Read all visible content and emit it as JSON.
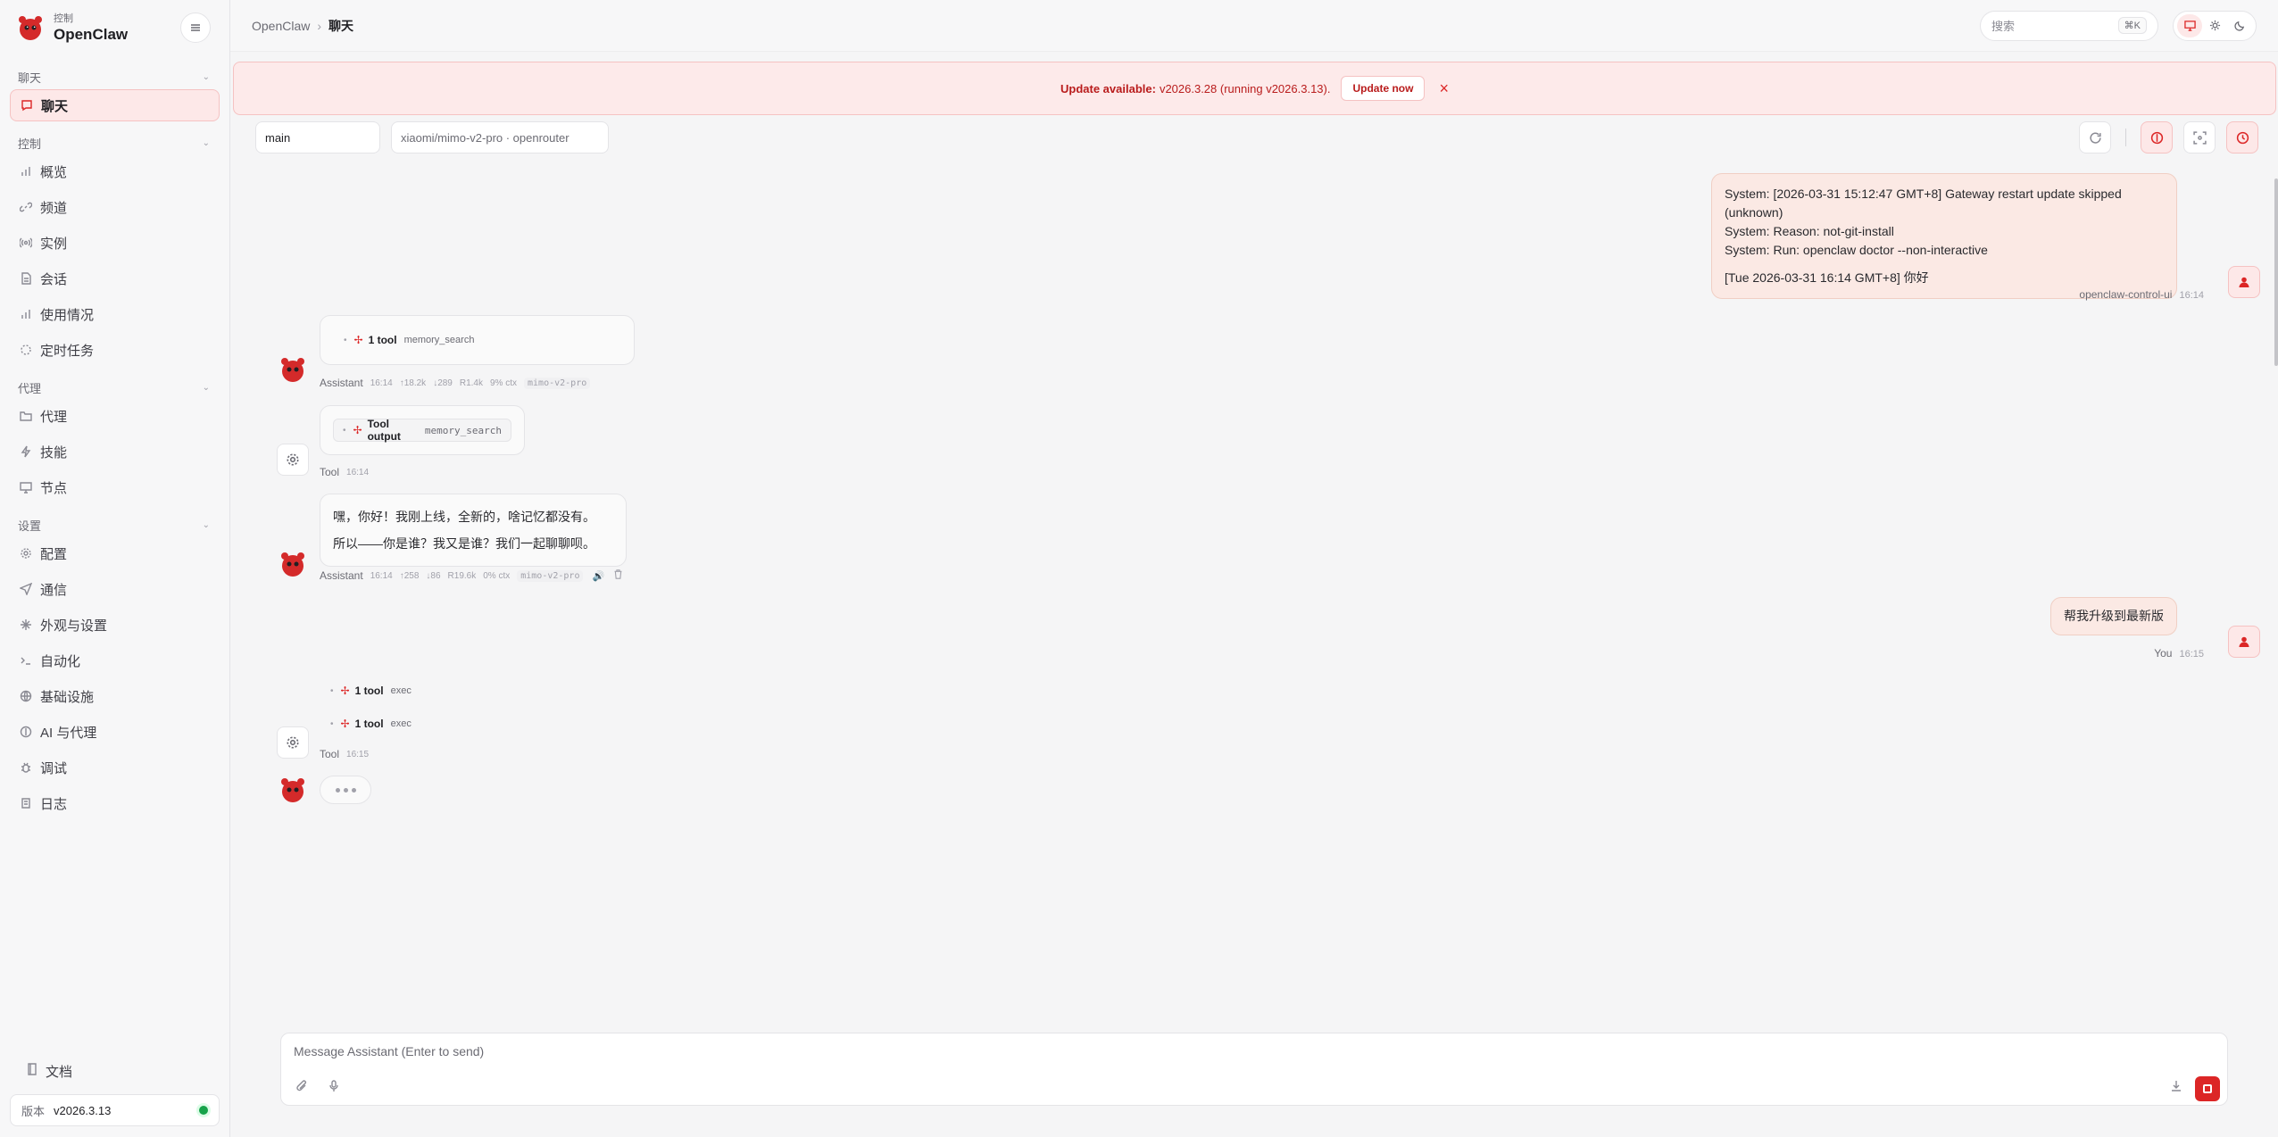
{
  "brand": {
    "sub": "控制",
    "name": "OpenClaw"
  },
  "sidebar": {
    "groups": [
      {
        "label": "聊天",
        "items": [
          {
            "label": "聊天",
            "icon": "message-icon"
          }
        ]
      },
      {
        "label": "控制",
        "items": [
          {
            "label": "概览",
            "icon": "bar-chart-icon"
          },
          {
            "label": "频道",
            "icon": "link-icon"
          },
          {
            "label": "实例",
            "icon": "radio-icon"
          },
          {
            "label": "会话",
            "icon": "document-icon"
          },
          {
            "label": "使用情况",
            "icon": "bar-chart-icon"
          },
          {
            "label": "定时任务",
            "icon": "loader-icon"
          }
        ]
      },
      {
        "label": "代理",
        "items": [
          {
            "label": "代理",
            "icon": "folder-icon"
          },
          {
            "label": "技能",
            "icon": "zap-icon"
          },
          {
            "label": "节点",
            "icon": "monitor-icon"
          }
        ]
      },
      {
        "label": "设置",
        "items": [
          {
            "label": "配置",
            "icon": "gear-icon"
          },
          {
            "label": "通信",
            "icon": "send-icon"
          },
          {
            "label": "外观与设置",
            "icon": "sparkle-icon"
          },
          {
            "label": "自动化",
            "icon": "terminal-icon"
          },
          {
            "label": "基础设施",
            "icon": "globe-icon"
          },
          {
            "label": "AI 与代理",
            "icon": "brain-icon"
          },
          {
            "label": "调试",
            "icon": "bug-icon"
          },
          {
            "label": "日志",
            "icon": "scroll-icon"
          }
        ]
      }
    ],
    "docs_label": "文档",
    "version_label": "版本",
    "version_value": "v2026.3.13"
  },
  "topbar": {
    "breadcrumb_root": "OpenClaw",
    "breadcrumb_sep": "›",
    "breadcrumb_current": "聊天",
    "search_placeholder": "搜索",
    "search_shortcut": "⌘K"
  },
  "banner": {
    "prefix": "Update available:",
    "text": "v2026.3.28 (running v2026.3.13).",
    "button": "Update now",
    "close": "×"
  },
  "controls": {
    "session": "main",
    "model": "xiaomi/mimo-v2-pro · openrouter"
  },
  "messages": {
    "m1": {
      "lines": [
        "System: [2026-03-31 15:12:47 GMT+8] Gateway restart update skipped (unknown)",
        "System: Reason: not-git-install",
        "System: Run: openclaw doctor --non-interactive"
      ],
      "last": "[Tue 2026-03-31 16:14 GMT+8] 你好",
      "sender": "openclaw-control-ui",
      "time": "16:14"
    },
    "m2": {
      "tool_count": "1 tool",
      "tool_name": "memory_search",
      "sender": "Assistant",
      "time": "16:14",
      "stats": [
        "↑18.2k",
        "↓289",
        "R1.4k",
        "9% ctx"
      ],
      "model": "mimo-v2-pro"
    },
    "m3": {
      "label": "Tool output",
      "tool_name": "memory_search",
      "sender": "Tool",
      "time": "16:14"
    },
    "m4": {
      "line1": "嘿，你好！我刚上线，全新的，啥记忆都没有。",
      "line2": "所以——你是谁？我又是谁？我们一起聊聊呗。",
      "sender": "Assistant",
      "time": "16:14",
      "stats": [
        "↑258",
        "↓86",
        "R19.6k",
        "0% ctx"
      ],
      "model": "mimo-v2-pro"
    },
    "m5": {
      "text": "帮我升级到最新版",
      "sender": "You",
      "time": "16:15"
    },
    "m6": {
      "tools": [
        {
          "count": "1 tool",
          "name": "exec"
        },
        {
          "count": "1 tool",
          "name": "exec"
        }
      ],
      "sender": "Tool",
      "time": "16:15"
    }
  },
  "composer": {
    "placeholder": "Message Assistant (Enter to send)"
  },
  "colors": {
    "accent": "#dc2626",
    "accent_bg": "#fde8e8",
    "user_bubble": "#fbe9e4",
    "status_ok": "#16a34a"
  }
}
